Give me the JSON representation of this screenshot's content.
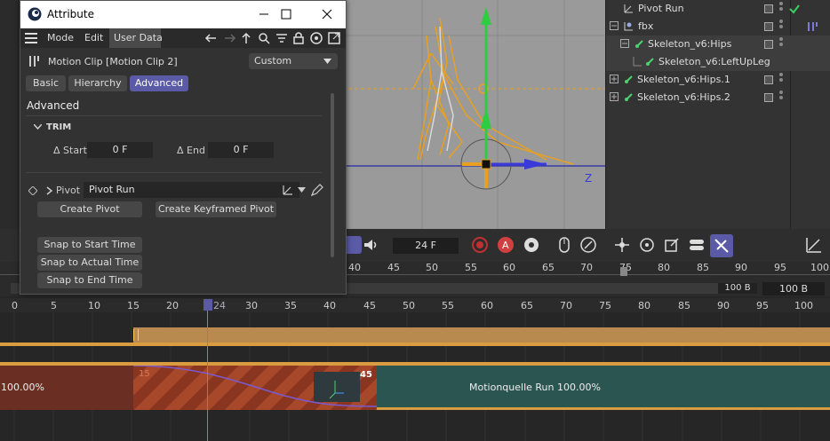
{
  "window": {
    "title": "Attribute"
  },
  "menu": {
    "mode": "Mode",
    "edit": "Edit",
    "user_data": "User Data"
  },
  "header": {
    "object": "Motion Clip [Motion Clip 2]",
    "preset": "Custom"
  },
  "tabs": {
    "basic": "Basic",
    "hierarchy": "Hierarchy",
    "advanced": "Advanced"
  },
  "section": {
    "title": "Advanced",
    "trim": "TRIM"
  },
  "trim": {
    "start_label": "Δ Start",
    "start_value": "0 F",
    "end_label": "Δ End",
    "end_value": "0 F"
  },
  "pivot": {
    "label": "Pivot",
    "value": "Pivot Run"
  },
  "buttons": {
    "create_pivot": "Create Pivot",
    "create_keyframed_pivot": "Create Keyframed Pivot",
    "snap_start": "Snap to Start Time",
    "snap_actual": "Snap to Actual Time",
    "snap_end": "Snap to End Time"
  },
  "objects": [
    {
      "label": "Pivot Run"
    },
    {
      "label": "fbx"
    },
    {
      "label": "Skeleton_v6:Hips"
    },
    {
      "label": "Skeleton_v6:LeftUpLeg"
    },
    {
      "label": "Skeleton_v6:Hips.1"
    },
    {
      "label": "Skeleton_v6:Hips.2"
    }
  ],
  "toolbar": {
    "frame": "24 F"
  },
  "ruler_top": [
    "40",
    "45",
    "50",
    "55",
    "60",
    "65",
    "70",
    "75",
    "80",
    "85",
    "90",
    "95",
    "100"
  ],
  "ruler_bottom": [
    "0",
    "5",
    "10",
    "15",
    "20",
    "24",
    "30",
    "35",
    "40",
    "45",
    "50",
    "55",
    "60",
    "65",
    "70",
    "75",
    "80",
    "85",
    "90",
    "95",
    "100"
  ],
  "range": {
    "end_a": "100 B",
    "end_b": "100 B"
  },
  "clips": {
    "left_percent": "100.00%",
    "transition_start": "15",
    "transition_end": "45",
    "run_label": "Motionquelle Run  100.00%"
  },
  "viewport": {
    "axis_label": "Z"
  },
  "colors": {
    "accent": "#5a5aa6",
    "clip_orange": "#c8a060",
    "clip_red": "#6a2e22",
    "clip_teal": "#2b5550",
    "curve": "#7a5ad0"
  }
}
